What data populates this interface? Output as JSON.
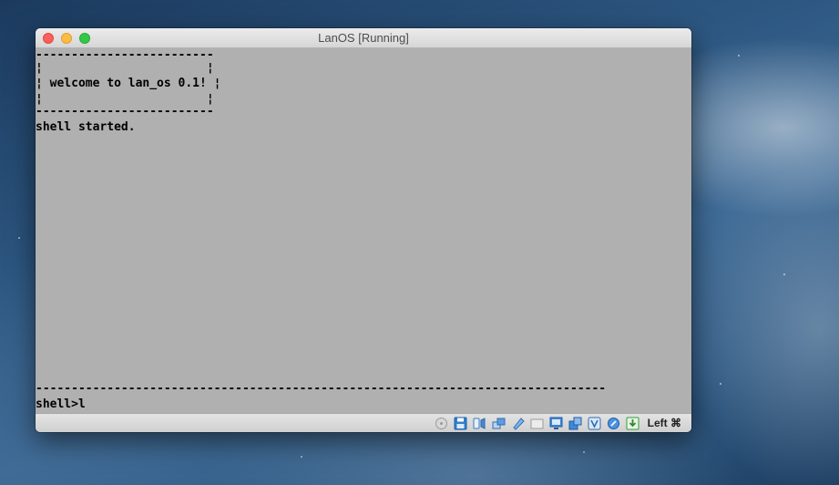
{
  "window": {
    "title": "LanOS [Running]"
  },
  "terminal": {
    "box_top": "-------------------------",
    "box_side_1": "¦                       ¦",
    "box_msg": "¦ welcome to lan_os 0.1! ¦",
    "box_side_2": "¦                       ¦",
    "box_bottom": "-------------------------",
    "status_line": "shell started.",
    "divider": "--------------------------------------------------------------------------------",
    "prompt_line": "shell>l"
  },
  "statusbar": {
    "host_key": "Left ⌘",
    "icons": [
      "optical-drive-icon",
      "floppy-disk-icon",
      "audio-icon",
      "network-icon",
      "usb-icon",
      "shared-folders-icon",
      "display-icon",
      "video-capture-icon",
      "virtualization-icon",
      "mouse-integration-icon",
      "keyboard-download-icon"
    ]
  },
  "colors": {
    "screen_background": "#b0b0b0",
    "screen_text": "#000000",
    "close": "#fc605b",
    "minimize": "#fdbc40",
    "maximize": "#34c84a"
  }
}
